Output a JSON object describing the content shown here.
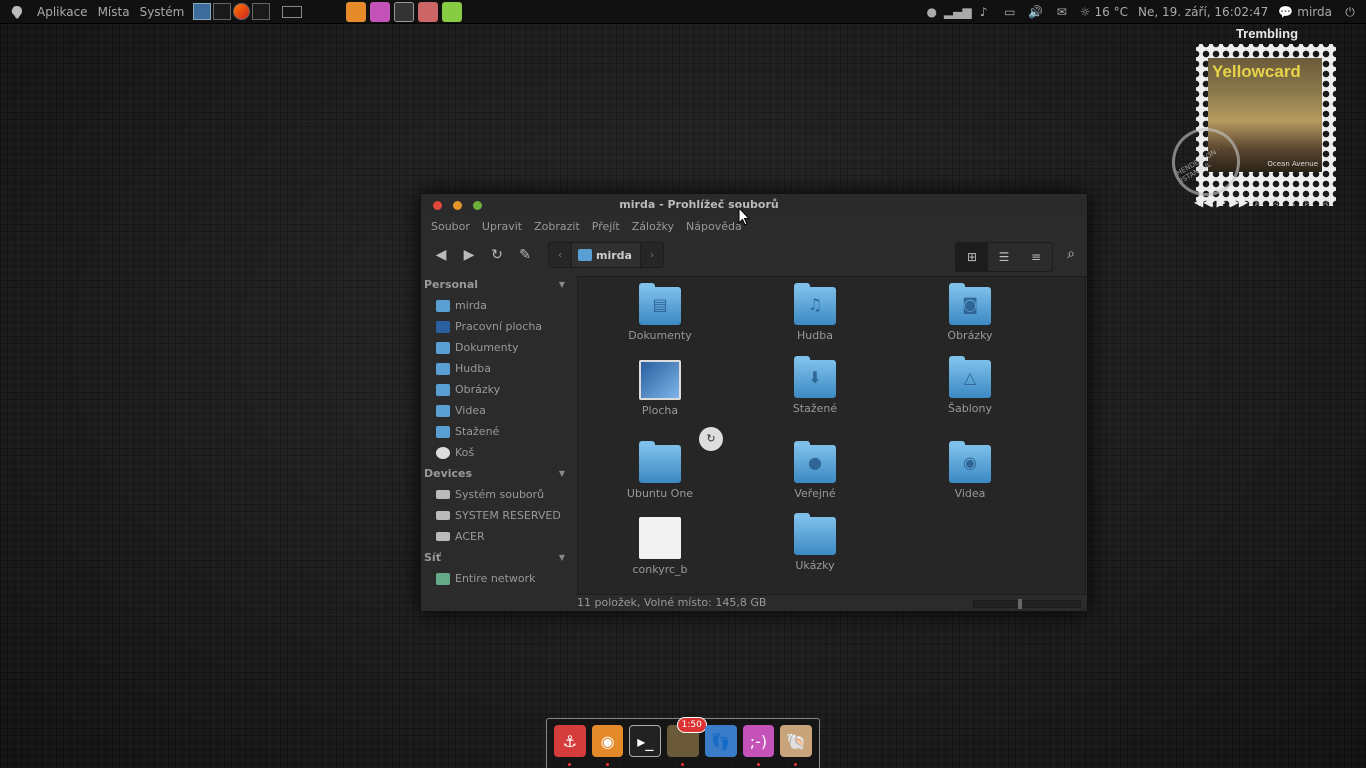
{
  "top_panel": {
    "menus": [
      "Aplikace",
      "Místa",
      "Systém"
    ],
    "temperature": "16 °C",
    "datetime": "Ne, 19. září, 16:02:47",
    "user": "mirda"
  },
  "music_widget": {
    "song_title": "Trembling",
    "artist_art_text": "Yellowcard",
    "album_art_text": "Ocean Avenue",
    "postmark_text": "HENDERSON · ISTANBUL",
    "rating_max": 5,
    "rating": 0
  },
  "window": {
    "title": "mirda - Prohlížeč souborů",
    "menu": [
      "Soubor",
      "Upravit",
      "Zobrazit",
      "Přejít",
      "Záložky",
      "Nápověda"
    ],
    "path_current": "mirda",
    "sidebar": {
      "sections": [
        {
          "label": "Personal",
          "items": [
            "mirda",
            "Pracovní plocha",
            "Dokumenty",
            "Hudba",
            "Obrázky",
            "Videa",
            "Stažené",
            "Koš"
          ]
        },
        {
          "label": "Devices",
          "items": [
            "Systém souborů",
            "SYSTEM RESERVED",
            "ACER"
          ]
        },
        {
          "label": "Síť",
          "items": [
            "Entire network"
          ]
        }
      ]
    },
    "files": [
      {
        "name": "Dokumenty",
        "icon": "documents-folder-icon"
      },
      {
        "name": "Hudba",
        "icon": "music-folder-icon"
      },
      {
        "name": "Obrázky",
        "icon": "pictures-folder-icon"
      },
      {
        "name": "Plocha",
        "icon": "desktop-icon"
      },
      {
        "name": "Stažené",
        "icon": "downloads-folder-icon"
      },
      {
        "name": "Šablony",
        "icon": "templates-folder-icon"
      },
      {
        "name": "Ubuntu One",
        "icon": "ubuntu-one-folder-icon"
      },
      {
        "name": "Veřejné",
        "icon": "public-folder-icon"
      },
      {
        "name": "Videa",
        "icon": "videos-folder-icon"
      },
      {
        "name": "conkyrc_b",
        "icon": "text-file-icon"
      },
      {
        "name": "Ukázky",
        "icon": "examples-folder-icon"
      }
    ],
    "status": "11 položek, Volné místo: 145,8 GB"
  },
  "dock": {
    "apps": [
      "anchor",
      "eye-viewer",
      "terminal",
      "photo-with-badge",
      "footprint",
      "chat",
      "shell-app"
    ],
    "badge_text": "1:50"
  }
}
